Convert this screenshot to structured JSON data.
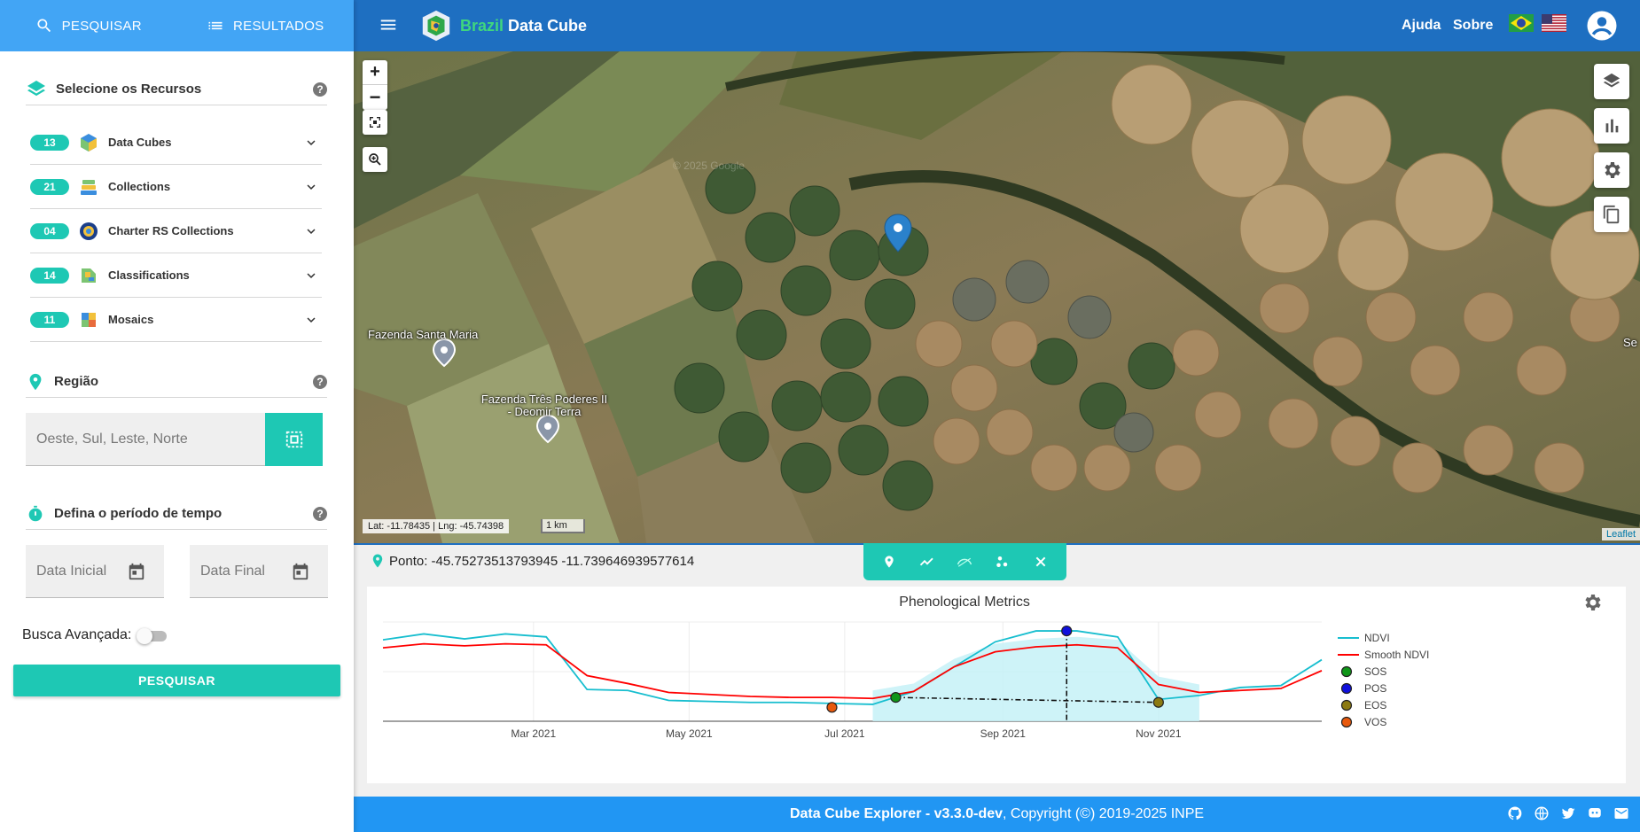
{
  "sidebar": {
    "tabs": [
      {
        "label": "PESQUISAR",
        "icon": "search-icon"
      },
      {
        "label": "RESULTADOS",
        "icon": "list-icon"
      }
    ],
    "resources": {
      "title": "Selecione os Recursos",
      "items": [
        {
          "count": "13",
          "label": "Data Cubes",
          "icon": "cube-icon"
        },
        {
          "count": "21",
          "label": "Collections",
          "icon": "stack-icon"
        },
        {
          "count": "04",
          "label": "Charter RS Collections",
          "icon": "charter-icon"
        },
        {
          "count": "14",
          "label": "Classifications",
          "icon": "map-classification-icon"
        },
        {
          "count": "11",
          "label": "Mosaics",
          "icon": "mosaic-icon"
        }
      ]
    },
    "region": {
      "title": "Região",
      "placeholder": "Oeste, Sul, Leste, Norte"
    },
    "period": {
      "title": "Defina o período de tempo",
      "start_placeholder": "Data Inicial",
      "end_placeholder": "Data Final"
    },
    "advanced_label": "Busca Avançada:",
    "search_button": "PESQUISAR"
  },
  "header": {
    "brand_green": "Brazil",
    "brand_white": "Data Cube",
    "help": "Ajuda",
    "about": "Sobre"
  },
  "map": {
    "labels": [
      {
        "text": "Fazenda Santa Maria"
      },
      {
        "text": "Fazenda Três Poderes II - Deomir Terra"
      },
      {
        "text": "Se"
      }
    ],
    "coords": "Lat: -11.78435 | Lng: -45.74398",
    "scale": "1 km",
    "attribution": "Leaflet",
    "watermark": "© 2025 Google"
  },
  "panel": {
    "point_text": "Ponto: -45.75273513793945 -11.739646939577614"
  },
  "chart_data": {
    "type": "line",
    "title": "Phenological Metrics",
    "x_ticks": [
      "Mar 2021",
      "May 2021",
      "Jul 2021",
      "Sep 2021",
      "Nov 2021"
    ],
    "dates": [
      "2021-01-01",
      "2021-01-17",
      "2021-02-02",
      "2021-02-18",
      "2021-03-06",
      "2021-03-22",
      "2021-04-07",
      "2021-04-23",
      "2021-05-09",
      "2021-05-25",
      "2021-06-10",
      "2021-06-26",
      "2021-07-12",
      "2021-07-28",
      "2021-08-13",
      "2021-08-29",
      "2021-09-14",
      "2021-09-30",
      "2021-10-16",
      "2021-11-01",
      "2021-11-17",
      "2021-12-03",
      "2021-12-19",
      "2022-01-04"
    ],
    "series": [
      {
        "name": "NDVI",
        "color": "#17becf",
        "values": [
          0.82,
          0.88,
          0.83,
          0.88,
          0.85,
          0.32,
          0.31,
          0.21,
          0.2,
          0.19,
          0.19,
          0.18,
          0.17,
          0.3,
          0.55,
          0.8,
          0.91,
          0.91,
          0.85,
          0.22,
          0.26,
          0.34,
          0.36,
          0.62
        ]
      },
      {
        "name": "Smooth NDVI",
        "color": "#ff0000",
        "values": [
          0.74,
          0.78,
          0.76,
          0.78,
          0.77,
          0.46,
          0.38,
          0.29,
          0.27,
          0.25,
          0.24,
          0.24,
          0.23,
          0.3,
          0.55,
          0.7,
          0.75,
          0.77,
          0.74,
          0.37,
          0.29,
          0.31,
          0.33,
          0.51
        ]
      }
    ],
    "metrics": [
      {
        "name": "SOS",
        "color": "#109618",
        "date": "2021-07-21",
        "value": 0.24
      },
      {
        "name": "POS",
        "color": "#1010dd",
        "date": "2021-09-26",
        "value": 0.91
      },
      {
        "name": "EOS",
        "color": "#8c7a12",
        "date": "2021-11-01",
        "value": 0.19
      },
      {
        "name": "VOS",
        "color": "#e8590c",
        "date": "2021-06-26",
        "value": 0.14
      }
    ],
    "ylim": [
      0,
      1
    ],
    "grid": true,
    "legend": "right"
  }
}
